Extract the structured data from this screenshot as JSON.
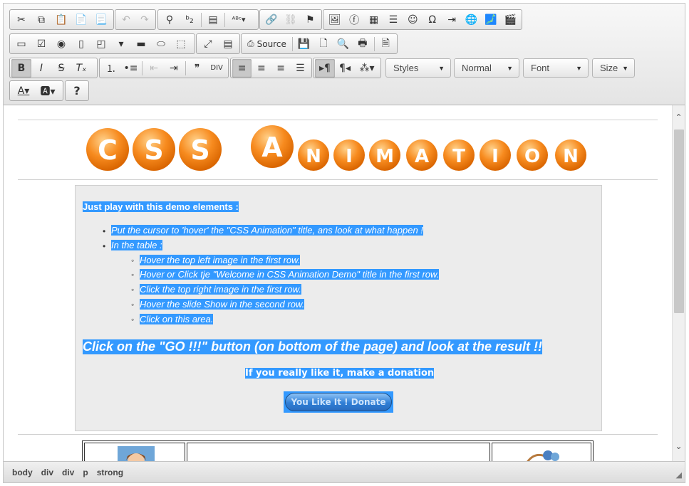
{
  "toolbar": {
    "source_label": "Source",
    "combos": {
      "styles": "Styles",
      "format": "Normal",
      "font": "Font",
      "size": "Size"
    }
  },
  "content": {
    "intro": "Just play with this demo elements :",
    "bullets": [
      "Put the cursor to 'hover' the \"CSS Animation\" title, ans look at what happen !",
      "In the table :"
    ],
    "sub_bullets": [
      "Hover the top left image in the first row.",
      "Hover or Click tje \"Welcome in CSS Animation Demo\" title in the first row.",
      "Click the top right image in the first row.",
      "Hover the slide Show in the second row.",
      "Click on this area."
    ],
    "go_text": "Click on the \"GO !!!\" button (on bottom of the page) and look at the result !!",
    "donate_text": "If you really like it, make a donation",
    "donate_button": "You Like It ! Donate"
  },
  "status": {
    "path": [
      "body",
      "div",
      "div",
      "p",
      "strong"
    ]
  },
  "colors": {
    "selection": "#3399ff",
    "logo_orange": "#f07f12"
  }
}
